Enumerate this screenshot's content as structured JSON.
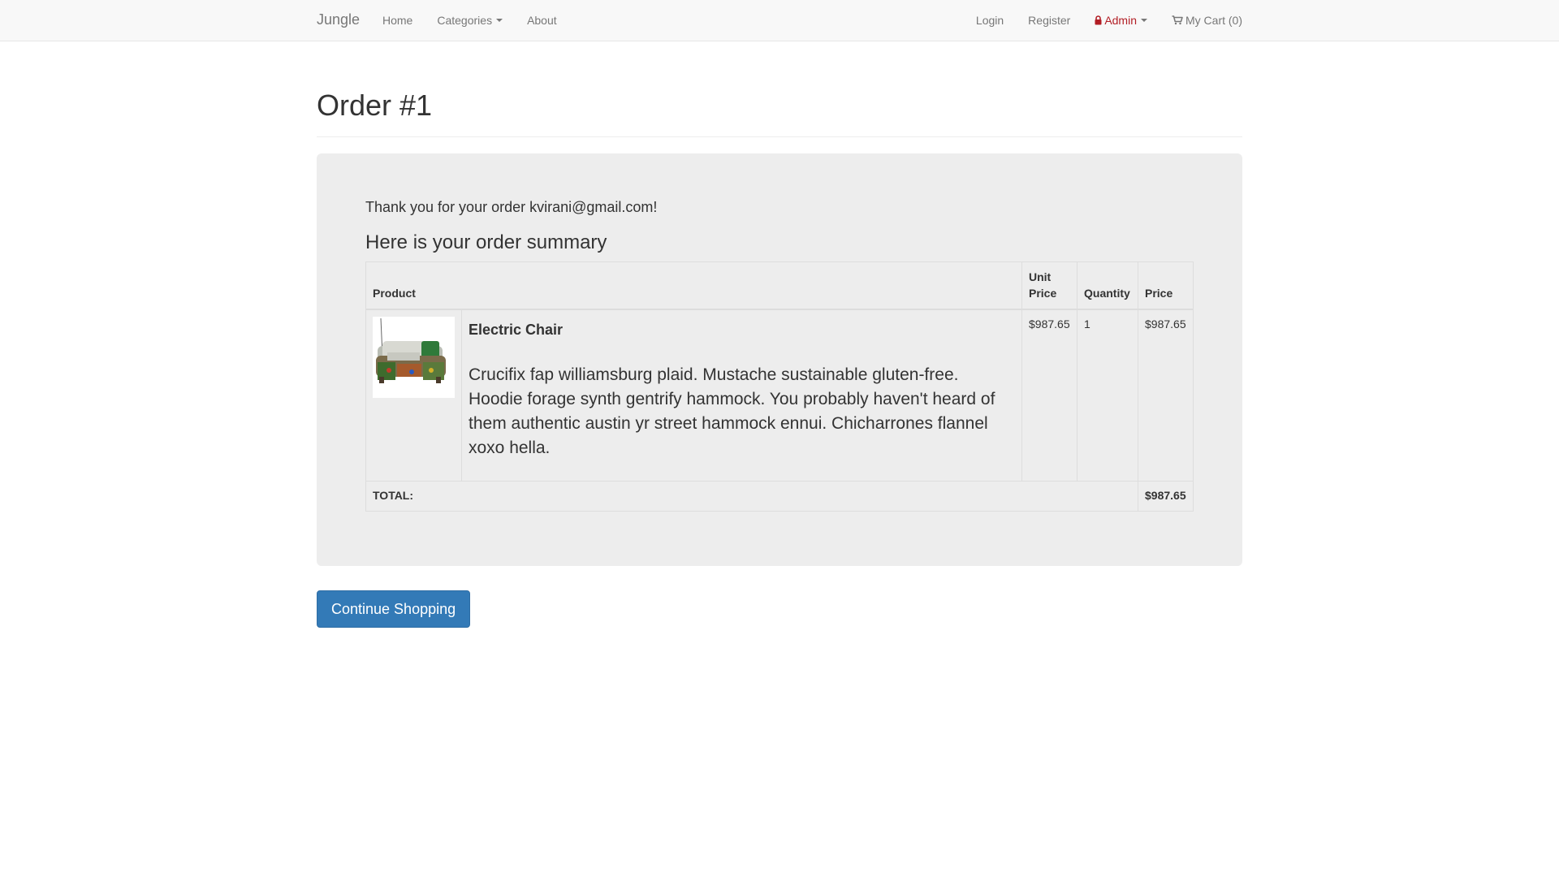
{
  "navbar": {
    "brand": "Jungle",
    "left_links": [
      {
        "label": "Home"
      },
      {
        "label": "Categories"
      },
      {
        "label": "About"
      }
    ],
    "right_links": [
      {
        "label": "Login"
      },
      {
        "label": "Register"
      },
      {
        "label": "Admin",
        "color": "#b21d24",
        "icon": "lock-icon"
      },
      {
        "label": "My Cart (0)",
        "icon": "cart-icon"
      }
    ]
  },
  "page": {
    "title": "Order #1"
  },
  "order": {
    "thanks": "Thank you for your order kvirani@gmail.com!",
    "summary_heading": "Here is your order summary",
    "table": {
      "headers": {
        "product": "Product",
        "unit_price_line1": "Unit",
        "unit_price_line2": "Price",
        "quantity": "Quantity",
        "price": "Price"
      },
      "items": [
        {
          "image_icon": "electric-chair-product-image",
          "name": "Electric Chair",
          "description": "Crucifix fap williamsburg plaid. Mustache sustainable gluten-free. Hoodie forage synth gentrify hammock. You probably haven't heard of them authentic austin yr street hammock ennui. Chicharrones flannel xoxo hella.",
          "unit_price": "$987.65",
          "quantity": "1",
          "price": "$987.65"
        }
      ],
      "total_label": "TOTAL:",
      "total_value": "$987.65"
    }
  },
  "actions": {
    "continue_label": "Continue Shopping",
    "continue_color": "#337ab7"
  }
}
